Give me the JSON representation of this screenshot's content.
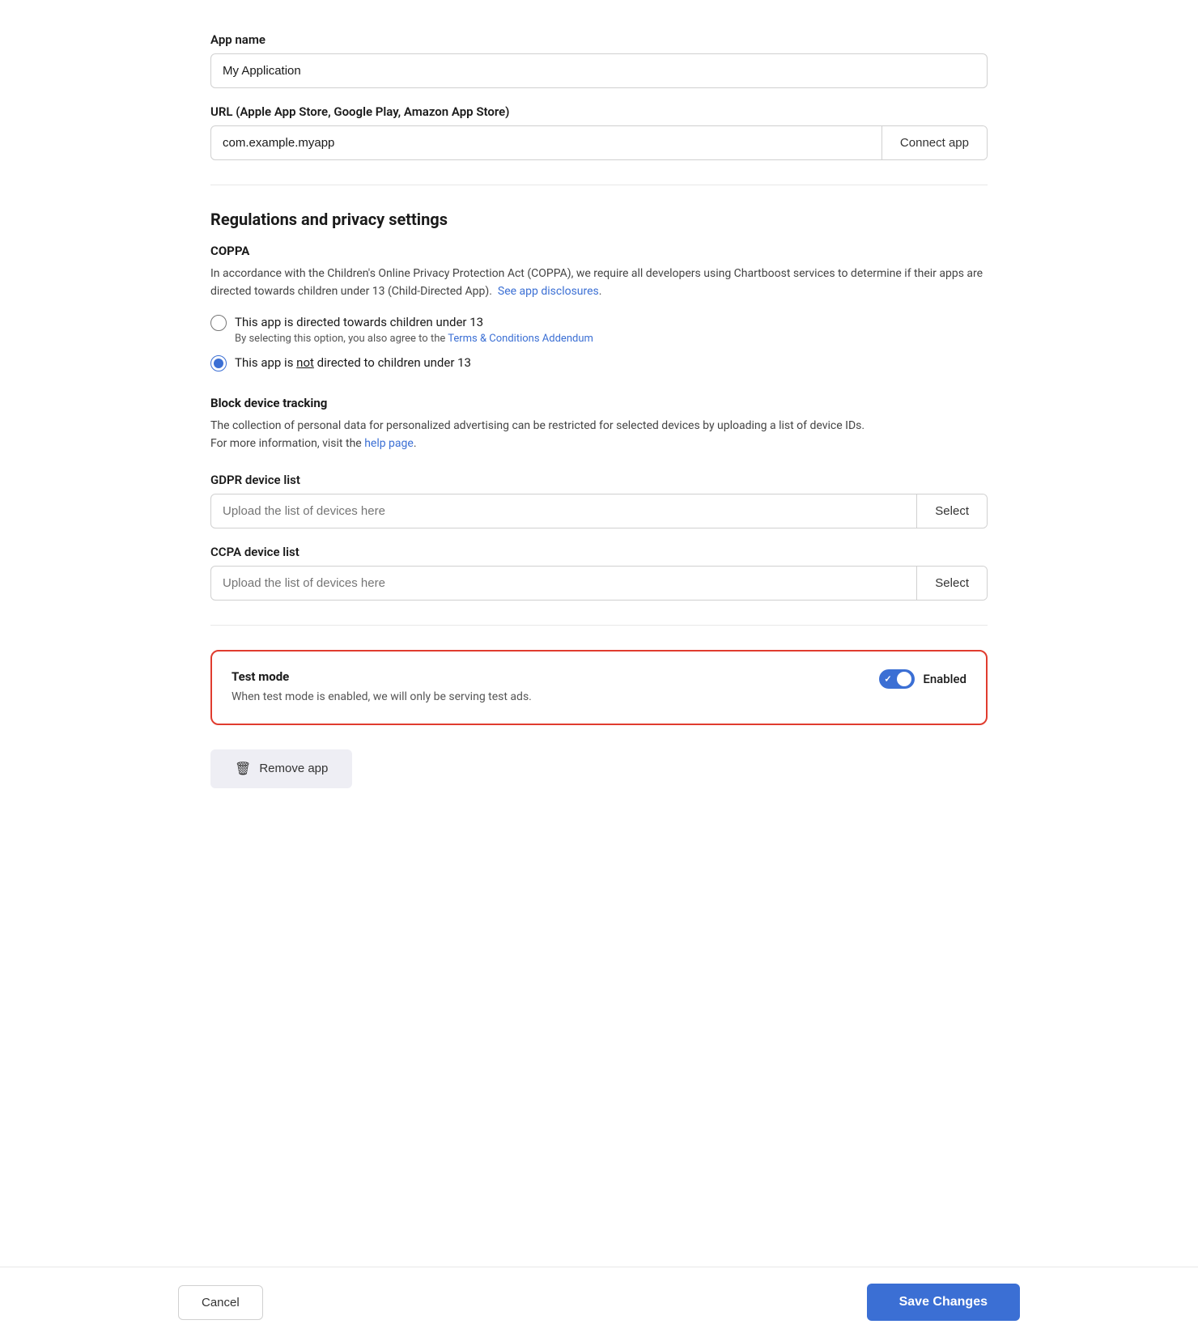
{
  "app_name": {
    "label": "App name",
    "value": "My Application",
    "placeholder": "My Application"
  },
  "app_url": {
    "label": "URL (Apple App Store, Google Play, Amazon App Store)",
    "value": "com.example.myapp",
    "placeholder": "com.example.myapp",
    "connect_button": "Connect app"
  },
  "regulations": {
    "title": "Regulations and privacy settings",
    "coppa": {
      "title": "COPPA",
      "description_part1": "In accordance with the Children's Online Privacy Protection Act (COPPA), we require all developers using Chartboost services to determine if their apps are directed towards children under 13 (Child-Directed App).",
      "description_link": "See app disclosures",
      "description_end": ".",
      "option1_label": "This app is directed towards children under 13",
      "option1_sub_prefix": "By selecting this option, you also agree to the ",
      "option1_sub_link": "Terms & Conditions Addendum",
      "option2_label_prefix": "This app is ",
      "option2_not": "not",
      "option2_label_suffix": " directed to children under 13"
    },
    "block_tracking": {
      "title": "Block device tracking",
      "description_part1": "The collection of personal data for personalized advertising can be restricted for selected devices by uploading a list of device IDs.",
      "description_part2": "For more information, visit the ",
      "help_link": "help page",
      "description_end": "."
    },
    "gdpr": {
      "label": "GDPR device list",
      "placeholder": "Upload the list of devices here",
      "select_button": "Select"
    },
    "ccpa": {
      "label": "CCPA device list",
      "placeholder": "Upload the list of devices here",
      "select_button": "Select"
    }
  },
  "test_mode": {
    "title": "Test mode",
    "description": "When test mode is enabled, we will only be serving test ads.",
    "toggle_label": "Enabled",
    "enabled": true
  },
  "remove_app": {
    "label": "Remove app"
  },
  "footer": {
    "cancel_label": "Cancel",
    "save_label": "Save Changes"
  }
}
